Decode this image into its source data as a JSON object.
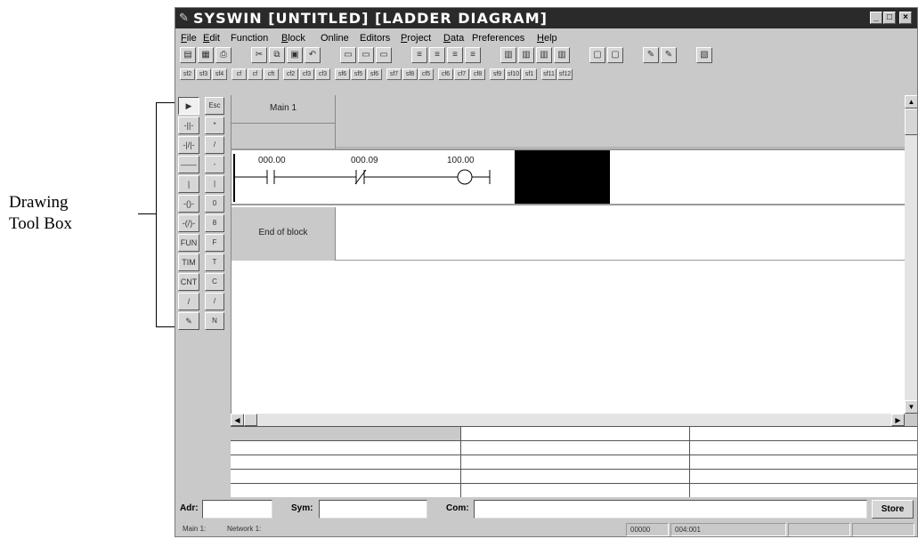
{
  "annotation": {
    "line1": "Drawing",
    "line2": "Tool Box"
  },
  "window": {
    "title": "SYSWIN [UNTITLED] [LADDER DIAGRAM]",
    "controls": {
      "minimize": "_",
      "maximize": "□",
      "close": "×"
    }
  },
  "menu": [
    {
      "label": "File",
      "key": "F"
    },
    {
      "label": "Edit",
      "key": "E"
    },
    {
      "label": "Function",
      "key": ""
    },
    {
      "label": "Block",
      "key": "B"
    },
    {
      "label": "Online",
      "key": ""
    },
    {
      "label": "Editors",
      "key": ""
    },
    {
      "label": "Project",
      "key": "P"
    },
    {
      "label": "Data",
      "key": "D"
    },
    {
      "label": "Preferences",
      "key": ""
    },
    {
      "label": "Help",
      "key": "H"
    }
  ],
  "toolbar": {
    "icons": [
      "new-icon",
      "open-icon",
      "print-icon",
      "cut-icon",
      "copy-icon",
      "paste-icon",
      "undo-icon",
      "block-icon",
      "block2-icon",
      "block3-icon",
      "network-icon",
      "network2-icon",
      "network3-icon",
      "network4-icon",
      "monitor-icon",
      "monitor2-icon",
      "monitor3-icon",
      "monitor4-icon",
      "online-icon",
      "online2-icon",
      "edit-icon",
      "edit2-icon",
      "window-icon"
    ],
    "row2": [
      "sf2",
      "sf3",
      "sf4",
      "cf",
      "cf",
      "cft",
      "cf2",
      "cf3",
      "cf3",
      "sf6",
      "sf5",
      "sf6",
      "sf7",
      "sf8",
      "cf5",
      "cf6",
      "cf7",
      "cf8",
      "sf9",
      "sf10",
      "sf1",
      "sf11",
      "sf12"
    ]
  },
  "toolbox": {
    "left": [
      "▶",
      "-||-",
      "-|/|-",
      "——",
      "|",
      "-()-",
      "-(/)-",
      "FUN",
      "TIM",
      "CNT",
      "/",
      "✎"
    ],
    "right": [
      "Esc",
      "*",
      "/",
      "-",
      "|",
      "0",
      "8",
      "F",
      "T",
      "C",
      "/",
      "N"
    ]
  },
  "ladder": {
    "network_label": "Main 1",
    "contacts": [
      "000.00",
      "000.09",
      "100.00"
    ],
    "end_label": "End of block"
  },
  "scroll": {
    "up": "▲",
    "down": "▼",
    "left": "◀",
    "right": "▶"
  },
  "fields": {
    "adr_label": "Adr:",
    "sym_label": "Sym:",
    "com_label": "Com:",
    "adr_value": "",
    "sym_value": "",
    "com_value": "",
    "store_label": "Store"
  },
  "status": {
    "cell1": "Main 1:",
    "cell2": "Network 1:",
    "cell3": "00000",
    "cell4": "004:001"
  }
}
